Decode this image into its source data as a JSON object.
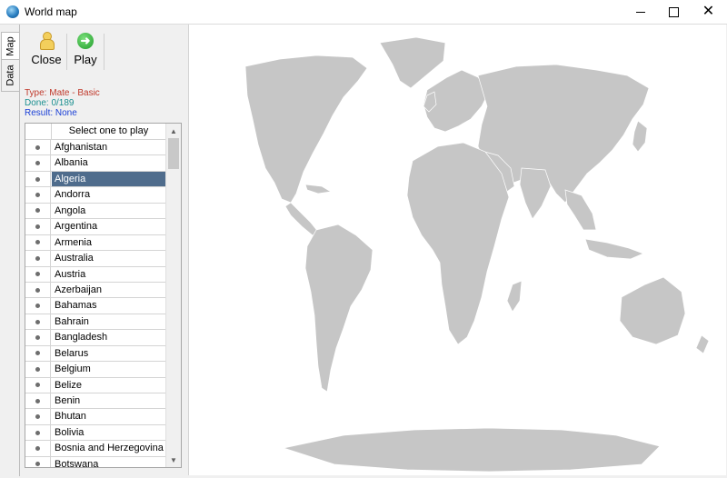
{
  "window": {
    "title": "World map",
    "colors": {
      "titlebar": "#ffffff",
      "selection": "#4f6c8c",
      "land": "#c6c6c6"
    }
  },
  "vtabs": [
    {
      "label": "Map"
    },
    {
      "label": "Data"
    }
  ],
  "toolbar": {
    "close_label": "Close",
    "play_label": "Play",
    "close_icon": "pawn-icon",
    "play_icon": "arrow-right-icon"
  },
  "status": {
    "type": "Type: Mate - Basic",
    "done": "Done: 0/189",
    "result": "Result: None"
  },
  "list": {
    "header": "Select one to play",
    "selected": "Algeria",
    "items": [
      "Afghanistan",
      "Albania",
      "Algeria",
      "Andorra",
      "Angola",
      "Argentina",
      "Armenia",
      "Australia",
      "Austria",
      "Azerbaijan",
      "Bahamas",
      "Bahrain",
      "Bangladesh",
      "Belarus",
      "Belgium",
      "Belize",
      "Benin",
      "Bhutan",
      "Bolivia",
      "Bosnia and Herzegovina",
      "Botswana"
    ]
  }
}
